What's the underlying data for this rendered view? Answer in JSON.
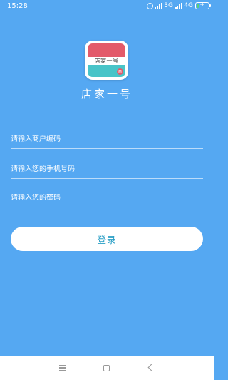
{
  "status_bar": {
    "time": "15:28",
    "network_1": "3G",
    "network_2": "4G",
    "battery_percent": 30
  },
  "app": {
    "logo_text": "店家一号",
    "badge_text": "商",
    "title": "店家一号"
  },
  "form": {
    "merchant_code_placeholder": "请输入商户编码",
    "phone_placeholder": "请输入您的手机号码",
    "password_placeholder": "请输入您的密码",
    "login_label": "登录"
  },
  "navigation": {
    "menu_icon": "menu-icon",
    "home_icon": "home-icon",
    "back_icon": "back-icon"
  },
  "colors": {
    "background": "#55a8f2",
    "button_text": "#2a9fc6",
    "logo_red": "#e35a6a",
    "logo_teal": "#48c4c8"
  }
}
